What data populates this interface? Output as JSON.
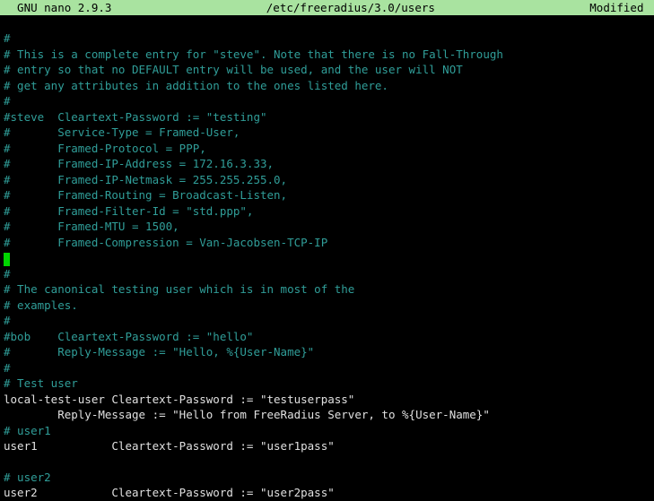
{
  "titlebar": {
    "left": "  GNU nano 2.9.3",
    "center": "/etc/freeradius/3.0/users",
    "right": "Modified "
  },
  "lines": [
    {
      "cls": "plain",
      "text": ""
    },
    {
      "cls": "comment",
      "text": "#"
    },
    {
      "cls": "comment",
      "text": "# This is a complete entry for \"steve\". Note that there is no Fall-Through"
    },
    {
      "cls": "comment",
      "text": "# entry so that no DEFAULT entry will be used, and the user will NOT"
    },
    {
      "cls": "comment",
      "text": "# get any attributes in addition to the ones listed here."
    },
    {
      "cls": "comment",
      "text": "#"
    },
    {
      "cls": "comment",
      "text": "#steve  Cleartext-Password := \"testing\""
    },
    {
      "cls": "comment",
      "text": "#       Service-Type = Framed-User,"
    },
    {
      "cls": "comment",
      "text": "#       Framed-Protocol = PPP,"
    },
    {
      "cls": "comment",
      "text": "#       Framed-IP-Address = 172.16.3.33,"
    },
    {
      "cls": "comment",
      "text": "#       Framed-IP-Netmask = 255.255.255.0,"
    },
    {
      "cls": "comment",
      "text": "#       Framed-Routing = Broadcast-Listen,"
    },
    {
      "cls": "comment",
      "text": "#       Framed-Filter-Id = \"std.ppp\","
    },
    {
      "cls": "comment",
      "text": "#       Framed-MTU = 1500,"
    },
    {
      "cls": "comment",
      "text": "#       Framed-Compression = Van-Jacobsen-TCP-IP"
    },
    {
      "cls": "cursor",
      "text": ""
    },
    {
      "cls": "comment",
      "text": "#"
    },
    {
      "cls": "comment",
      "text": "# The canonical testing user which is in most of the"
    },
    {
      "cls": "comment",
      "text": "# examples."
    },
    {
      "cls": "comment",
      "text": "#"
    },
    {
      "cls": "comment",
      "text": "#bob    Cleartext-Password := \"hello\""
    },
    {
      "cls": "comment",
      "text": "#       Reply-Message := \"Hello, %{User-Name}\""
    },
    {
      "cls": "comment",
      "text": "#"
    },
    {
      "cls": "comment",
      "text": "# Test user"
    },
    {
      "cls": "plain",
      "text": "local-test-user Cleartext-Password := \"testuserpass\""
    },
    {
      "cls": "plain",
      "text": "        Reply-Message := \"Hello from FreeRadius Server, to %{User-Name}\""
    },
    {
      "cls": "comment",
      "text": "# user1"
    },
    {
      "cls": "plain",
      "text": "user1           Cleartext-Password := \"user1pass\""
    },
    {
      "cls": "plain",
      "text": ""
    },
    {
      "cls": "comment",
      "text": "# user2"
    },
    {
      "cls": "plain",
      "text": "user2           Cleartext-Password := \"user2pass\""
    }
  ]
}
